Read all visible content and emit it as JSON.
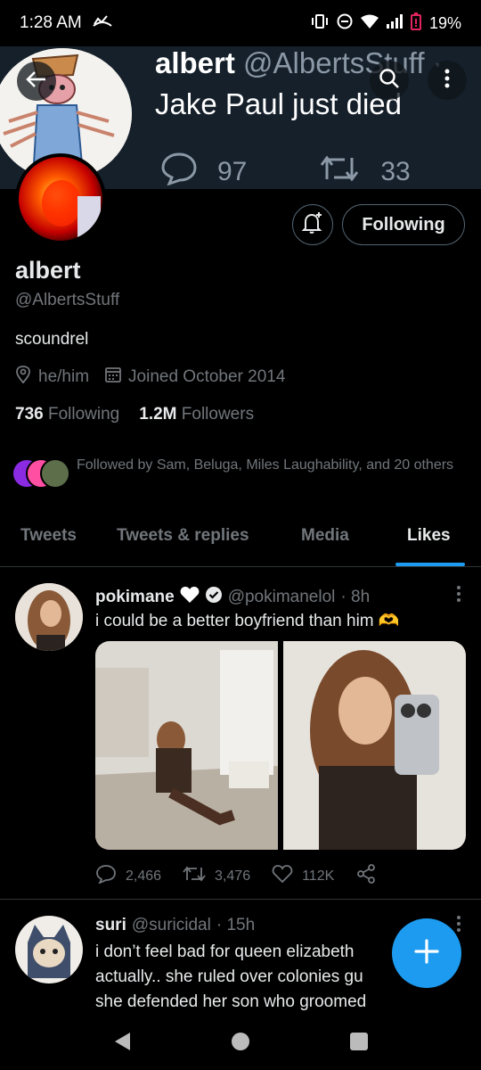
{
  "status_bar": {
    "time": "1:28 AM",
    "battery": "19%"
  },
  "banner": {
    "name": "albert",
    "handle": "@AlbertsStuff",
    "separator": "·",
    "text": "Jake Paul just died",
    "replies": "97",
    "retweets": "33"
  },
  "profile": {
    "display_name": "albert",
    "handle": "@AlbertsStuff",
    "bio": "scoundrel",
    "pronouns": "he/him",
    "joined": "Joined October 2014",
    "following_count": "736",
    "following_label": "Following",
    "followers_count": "1.2M",
    "followers_label": "Followers",
    "followed_by": "Followed by Sam, Beluga, Miles Laughability, and 20 others",
    "follow_button": "Following"
  },
  "tabs": [
    {
      "label": "Tweets"
    },
    {
      "label": "Tweets & replies"
    },
    {
      "label": "Media"
    },
    {
      "label": "Likes",
      "active": true
    }
  ],
  "tweets": [
    {
      "name": "pokimane",
      "handle": "@pokimanelol",
      "time": "· 8h",
      "text": "i could be a better boyfriend than him 🫶",
      "replies": "2,466",
      "retweets": "3,476",
      "likes": "112K"
    },
    {
      "name": "suri",
      "handle": "@suricidal",
      "time": "· 15h",
      "line1": "i don’t feel bad for queen elizabeth",
      "line2": "actually.. she ruled over colonies gu",
      "line3": "she defended her son who groomed"
    }
  ],
  "colors": {
    "accent": "#1d9bf0",
    "background": "#000000",
    "banner": "#15202b"
  }
}
